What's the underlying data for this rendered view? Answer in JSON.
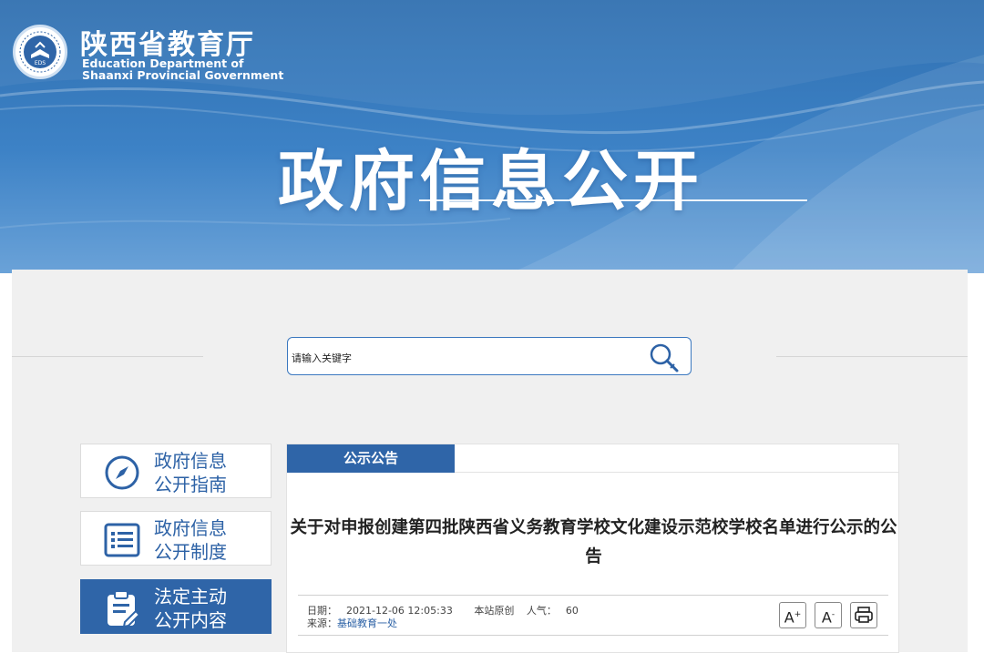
{
  "header": {
    "org_name_cn": "陕西省教育厅",
    "org_name_en_line1": "Education Department of",
    "org_name_en_line2": "Shaanxi Provincial Government",
    "logo_text": "EDS",
    "page_title": "政府信息公开"
  },
  "search": {
    "placeholder": "请输入关键字"
  },
  "sidebar": {
    "items": [
      {
        "line1": "政府信息",
        "line2": "公开指南",
        "icon": "compass-icon"
      },
      {
        "line1": "政府信息",
        "line2": "公开制度",
        "icon": "list-icon"
      },
      {
        "line1": "法定主动",
        "line2": "公开内容",
        "icon": "clipboard-edit-icon"
      }
    ]
  },
  "content": {
    "tab_label": "公示公告",
    "article_title": "关于对申报创建第四批陕西省义务教育学校文化建设示范校学校名单进行公示的公告",
    "meta": {
      "date_label": "日期：",
      "date_value": "2021-12-06 12:05:33",
      "origin": "本站原创",
      "views_label": "人气：",
      "views_value": "60",
      "source_label": "来源：",
      "source_value": "基础教育一处"
    },
    "tools": {
      "increase_font": "A",
      "decrease_font": "A",
      "increase_sup": "+",
      "decrease_sup": "-"
    }
  },
  "colors": {
    "brand_blue": "#2f65a8",
    "banner_blue": "#3d82c6",
    "panel_gray": "#f0f0f0"
  }
}
